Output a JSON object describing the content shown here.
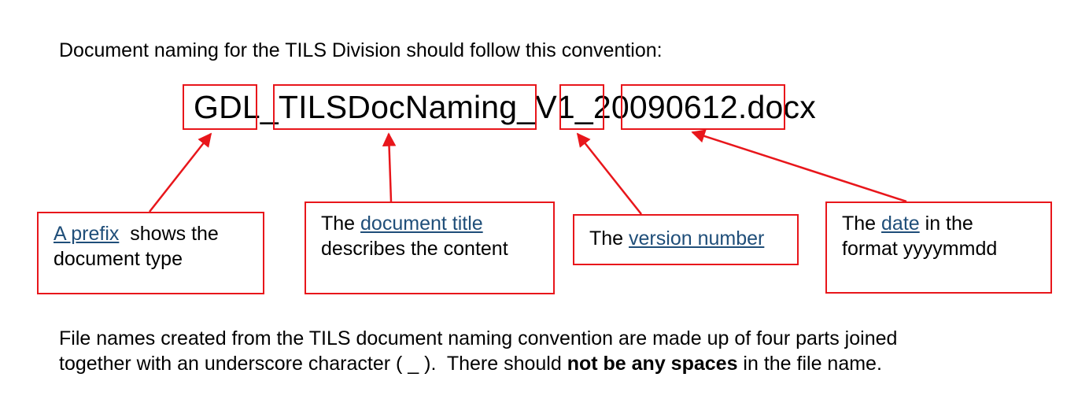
{
  "intro": "Document naming for the TILS Division should follow this convention:",
  "filename": {
    "prefix": "GDL",
    "sep1": "_",
    "title": "TILSDocNaming",
    "sep2": "_",
    "version": "V1",
    "sep3": "_",
    "date": "20090612",
    "extension": ".docx"
  },
  "callouts": {
    "prefix": {
      "link": "A prefix",
      "rest1": "  shows the",
      "rest2": "document type"
    },
    "title": {
      "pre": "The ",
      "link": "document title",
      "rest2": "describes the content"
    },
    "version": {
      "pre": "The ",
      "link": "version number"
    },
    "date": {
      "pre": "The ",
      "link": "date",
      "post": " in the",
      "rest2": "format yyyymmdd"
    }
  },
  "footer": {
    "line1": "File names created from the TILS document naming convention are made up of four parts joined",
    "line2_pre": "together with an underscore character ( _ ).  There should ",
    "line2_bold": "not be any spaces",
    "line2_post": " in the file name."
  },
  "colors": {
    "accent": "#e8161b",
    "link": "#1f4e79"
  }
}
